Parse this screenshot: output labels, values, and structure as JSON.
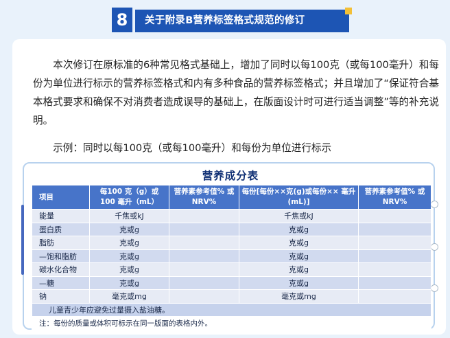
{
  "header": {
    "number": "8",
    "title": "关于附录B营养标签格式规范的修订"
  },
  "body": {
    "paragraph": "本次修订在原标准的6种常见格式基础上，增加了同时以每100克（或每100毫升）和每份为单位进行标示的营养标签格式和内有多种食品的营养标签格式；并且增加了“保证符合基本格式要求和确保不对消费者造成误导的基础上，在版面设计时可进行适当调整”等的补充说明。",
    "example": "示例：同时以每100克（或每100毫升）和每份为单位进行标示"
  },
  "table": {
    "title": "营养成分表",
    "headers": [
      "项目",
      "每100 克（g）或 100 毫升（mL）",
      "营养素参考值% 或NRV%",
      "每份[每份××克(g)或每份×× 毫升(mL)]",
      "营养素参考值% 或NRV%"
    ],
    "rows": [
      [
        "能量",
        "千焦或kJ",
        "",
        "千焦或kJ",
        ""
      ],
      [
        "蛋白质",
        "克或g",
        "",
        "克或g",
        ""
      ],
      [
        "脂肪",
        "克或g",
        "",
        "克或g",
        ""
      ],
      [
        "—饱和脂肪",
        "克或g",
        "",
        "克或g",
        ""
      ],
      [
        "碳水化合物",
        "克或g",
        "",
        "克或g",
        ""
      ],
      [
        "—糖",
        "克或g",
        "",
        "克或g",
        ""
      ],
      [
        "钠",
        "毫克或mg",
        "",
        "毫克或mg",
        ""
      ]
    ],
    "warning": "儿童青少年应避免过量摄入盐油糖。",
    "note": "注：每份的质量或体积可标示在同一版面的表格内外。"
  },
  "colors": {
    "header_blue": "#1d55b4",
    "accent_yellow": "#f3c037",
    "table_header": "#4774c9",
    "title_navy": "#0f2f74"
  }
}
